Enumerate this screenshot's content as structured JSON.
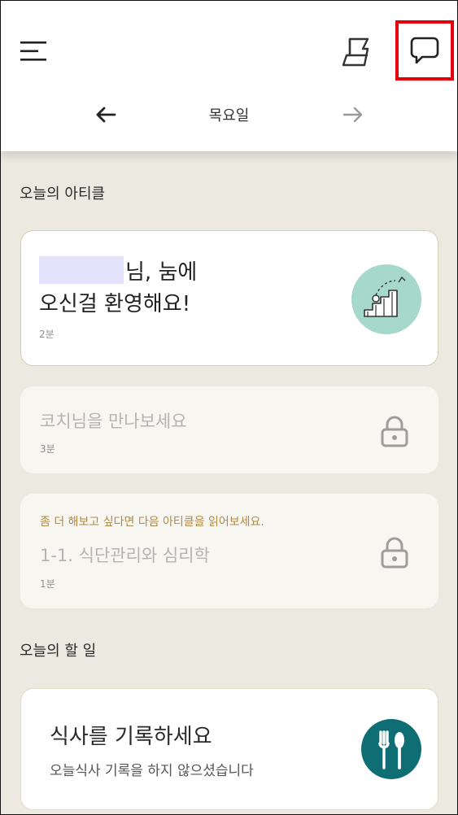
{
  "header": {
    "menu_icon": "hamburger-menu-icon",
    "flag_icon": "flag-icon",
    "chat_icon": "chat-bubble-icon",
    "prev_icon": "arrow-left-icon",
    "next_icon": "arrow-right-icon",
    "day": "목요일"
  },
  "articles": {
    "section_title": "오늘의 아티클",
    "items": [
      {
        "title_line1": "님, 눔에",
        "title_line2": "오신걸 환영해요!",
        "duration": "2분",
        "image_icon": "stairs-illustration-icon"
      },
      {
        "title": "코치님을 만나보세요",
        "duration": "3분",
        "locked": true,
        "lock_icon": "lock-icon"
      },
      {
        "hint": "좀 더 해보고 싶다면 다음 아티클을 읽어보세요.",
        "title": "1-1. 식단관리와 심리학",
        "duration": "1분",
        "locked": true,
        "lock_icon": "lock-icon"
      }
    ]
  },
  "todos": {
    "section_title": "오늘의 할 일",
    "items": [
      {
        "title": "식사를 기록하세요",
        "subtitle": "오늘식사 기록을 하지 않으셨습니다",
        "icon": "fork-spoon-icon"
      }
    ]
  },
  "colors": {
    "background": "#ece9e1",
    "highlight": "#e3000b",
    "accent_teal": "#0f6e73",
    "mint": "#a6d9cc",
    "hint_gold": "#b08a44"
  }
}
